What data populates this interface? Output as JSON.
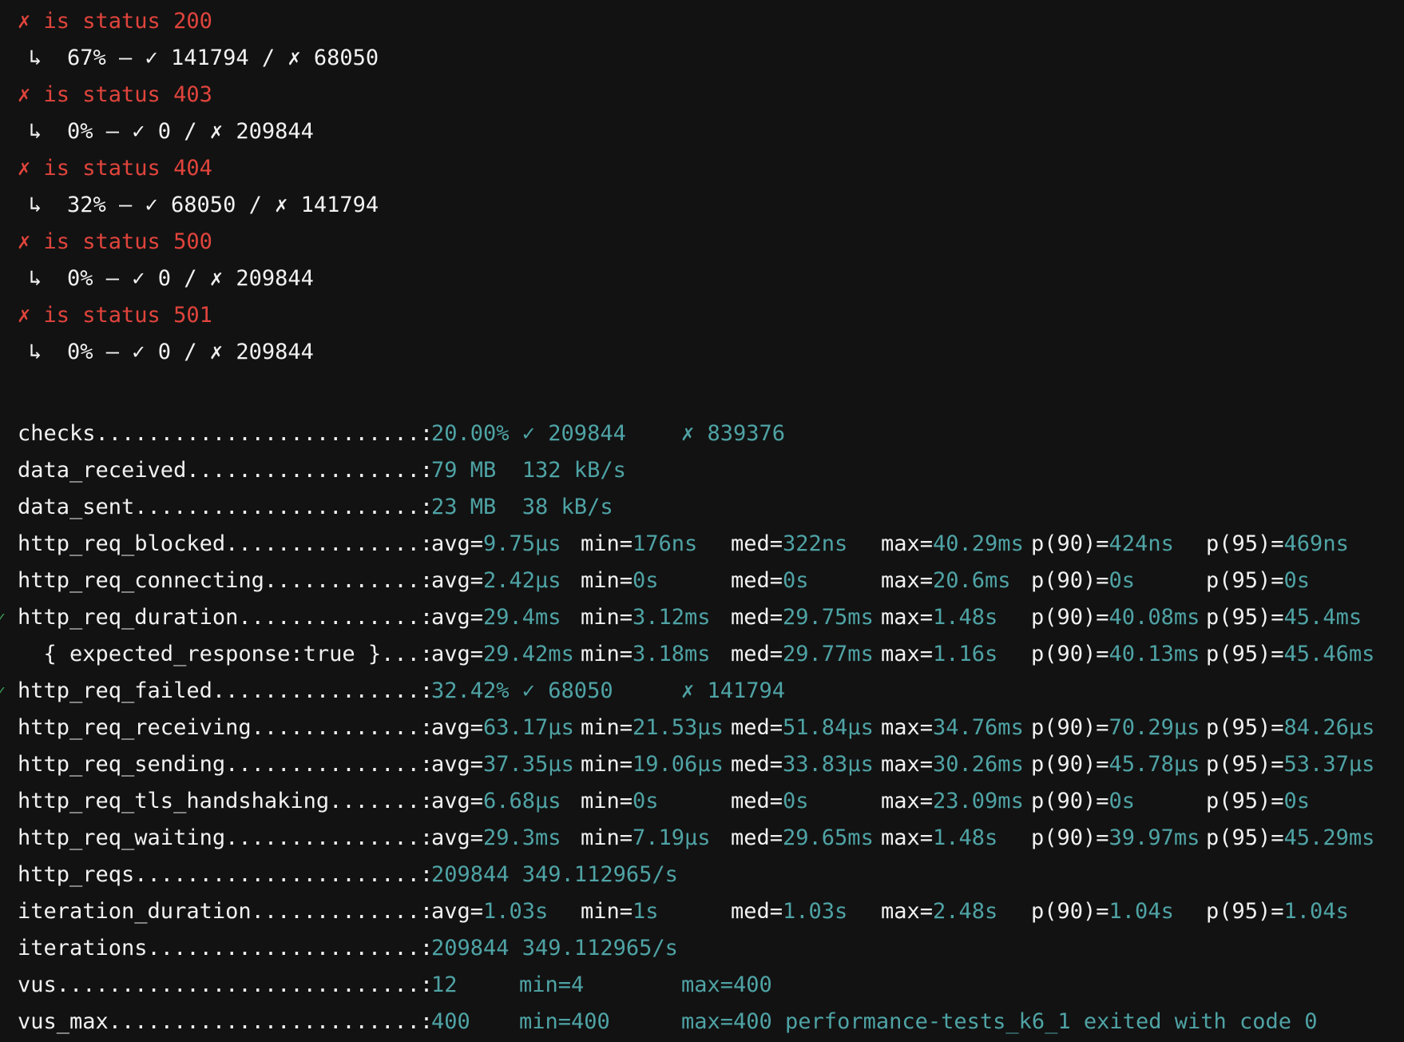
{
  "checks_group": [
    {
      "name": "is status 200",
      "mark": "✗",
      "arrow": "↳",
      "pct": "67%",
      "sep": "—",
      "pass_mark": "✓",
      "pass": "141794",
      "slash": "/",
      "fail_mark": "✗",
      "fail": "68050"
    },
    {
      "name": "is status 403",
      "mark": "✗",
      "arrow": "↳",
      "pct": "0%",
      "sep": "—",
      "pass_mark": "✓",
      "pass": "0",
      "slash": "/",
      "fail_mark": "✗",
      "fail": "209844"
    },
    {
      "name": "is status 404",
      "mark": "✗",
      "arrow": "↳",
      "pct": "32%",
      "sep": "—",
      "pass_mark": "✓",
      "pass": "68050",
      "slash": "/",
      "fail_mark": "✗",
      "fail": "141794"
    },
    {
      "name": "is status 500",
      "mark": "✗",
      "arrow": "↳",
      "pct": "0%",
      "sep": "—",
      "pass_mark": "✓",
      "pass": "0",
      "slash": "/",
      "fail_mark": "✗",
      "fail": "209844"
    },
    {
      "name": "is status 501",
      "mark": "✗",
      "arrow": "↳",
      "pct": "0%",
      "sep": "—",
      "pass_mark": "✓",
      "pass": "0",
      "slash": "/",
      "fail_mark": "✗",
      "fail": "209844"
    }
  ],
  "metrics": [
    {
      "label": "checks.........................:",
      "threshold": "",
      "values": [
        "20.00% ✓ 209844",
        "",
        "✗ 839376"
      ]
    },
    {
      "label": "data_received..................:",
      "threshold": "",
      "values": [
        "79 MB  132 kB/s"
      ]
    },
    {
      "label": "data_sent......................:",
      "threshold": "",
      "values": [
        "23 MB  38 kB/s"
      ]
    },
    {
      "label": "http_req_blocked...............:",
      "threshold": "",
      "stats": [
        [
          "avg=",
          "9.75µs"
        ],
        [
          "min=",
          "176ns"
        ],
        [
          "med=",
          "322ns"
        ],
        [
          "max=",
          "40.29ms"
        ],
        [
          "p(90)=",
          "424ns"
        ],
        [
          "p(95)=",
          "469ns"
        ]
      ]
    },
    {
      "label": "http_req_connecting............:",
      "threshold": "",
      "stats": [
        [
          "avg=",
          "2.42µs"
        ],
        [
          "min=",
          "0s"
        ],
        [
          "med=",
          "0s"
        ],
        [
          "max=",
          "20.6ms"
        ],
        [
          "p(90)=",
          "0s"
        ],
        [
          "p(95)=",
          "0s"
        ]
      ]
    },
    {
      "label": "http_req_duration..............:",
      "threshold": "✓",
      "stats": [
        [
          "avg=",
          "29.4ms"
        ],
        [
          "min=",
          "3.12ms"
        ],
        [
          "med=",
          "29.75ms"
        ],
        [
          "max=",
          "1.48s"
        ],
        [
          "p(90)=",
          "40.08ms"
        ],
        [
          "p(95)=",
          "45.4ms"
        ]
      ]
    },
    {
      "label": "  { expected_response:true }...:",
      "threshold": "",
      "stats": [
        [
          "avg=",
          "29.42ms"
        ],
        [
          "min=",
          "3.18ms"
        ],
        [
          "med=",
          "29.77ms"
        ],
        [
          "max=",
          "1.16s"
        ],
        [
          "p(90)=",
          "40.13ms"
        ],
        [
          "p(95)=",
          "45.46ms"
        ]
      ]
    },
    {
      "label": "http_req_failed................:",
      "threshold": "✓",
      "values": [
        "32.42% ✓ 68050",
        "",
        "✗ 141794"
      ]
    },
    {
      "label": "http_req_receiving.............:",
      "threshold": "",
      "stats": [
        [
          "avg=",
          "63.17µs"
        ],
        [
          "min=",
          "21.53µs"
        ],
        [
          "med=",
          "51.84µs"
        ],
        [
          "max=",
          "34.76ms"
        ],
        [
          "p(90)=",
          "70.29µs"
        ],
        [
          "p(95)=",
          "84.26µs"
        ]
      ]
    },
    {
      "label": "http_req_sending...............:",
      "threshold": "",
      "stats": [
        [
          "avg=",
          "37.35µs"
        ],
        [
          "min=",
          "19.06µs"
        ],
        [
          "med=",
          "33.83µs"
        ],
        [
          "max=",
          "30.26ms"
        ],
        [
          "p(90)=",
          "45.78µs"
        ],
        [
          "p(95)=",
          "53.37µs"
        ]
      ]
    },
    {
      "label": "http_req_tls_handshaking.......:",
      "threshold": "",
      "stats": [
        [
          "avg=",
          "6.68µs"
        ],
        [
          "min=",
          "0s"
        ],
        [
          "med=",
          "0s"
        ],
        [
          "max=",
          "23.09ms"
        ],
        [
          "p(90)=",
          "0s"
        ],
        [
          "p(95)=",
          "0s"
        ]
      ]
    },
    {
      "label": "http_req_waiting...............:",
      "threshold": "",
      "stats": [
        [
          "avg=",
          "29.3ms"
        ],
        [
          "min=",
          "7.19µs"
        ],
        [
          "med=",
          "29.65ms"
        ],
        [
          "max=",
          "1.48s"
        ],
        [
          "p(90)=",
          "39.97ms"
        ],
        [
          "p(95)=",
          "45.29ms"
        ]
      ]
    },
    {
      "label": "http_reqs......................:",
      "threshold": "",
      "values": [
        "209844 349.112965/s"
      ]
    },
    {
      "label": "iteration_duration.............:",
      "threshold": "",
      "stats": [
        [
          "avg=",
          "1.03s"
        ],
        [
          "min=",
          "1s"
        ],
        [
          "med=",
          "1.03s"
        ],
        [
          "max=",
          "2.48s"
        ],
        [
          "p(90)=",
          "1.04s"
        ],
        [
          "p(95)=",
          "1.04s"
        ]
      ]
    },
    {
      "label": "iterations.....................:",
      "threshold": "",
      "values": [
        "209844 349.112965/s"
      ]
    },
    {
      "label": "vus............................:",
      "threshold": "",
      "values": [
        "12",
        "min=4",
        "max=400"
      ]
    },
    {
      "label": "vus_max........................:",
      "threshold": "",
      "values": [
        "400",
        "min=400",
        "max=400 performance-tests_k6_1 exited with code 0"
      ]
    }
  ],
  "colors": {
    "background": "#121212",
    "text": "#f2f2f2",
    "failed_check": "#e0443c",
    "value": "#4fa3a5",
    "threshold_pass": "#3ba55c"
  }
}
